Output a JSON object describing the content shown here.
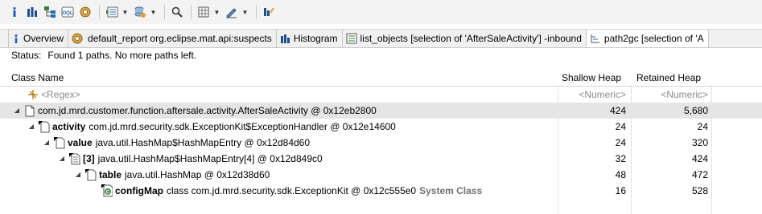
{
  "toolbar": {
    "icons": [
      "info-icon",
      "histogram-icon",
      "dominator-tree-icon",
      "oql-icon",
      "heap-dump-overview-icon",
      "query-browser-icon",
      "find-object-icon",
      "search-icon",
      "export-icon",
      "edit-icon",
      "pin-icon"
    ]
  },
  "tabs": [
    {
      "label": "Overview",
      "icon": "info-icon"
    },
    {
      "label": "default_report  org.eclipse.mat.api:suspects",
      "icon": "report-icon"
    },
    {
      "label": "Histogram",
      "icon": "histogram-icon"
    },
    {
      "label": "list_objects [selection of 'AfterSaleActivity'] -inbound",
      "icon": "list-objects-icon"
    },
    {
      "label": "path2gc [selection of 'A",
      "icon": "path2gc-icon"
    }
  ],
  "status": {
    "label": "Status:",
    "text": "Found 1 paths. No more paths left."
  },
  "columns": {
    "name": "Class Name",
    "shallow": "Shallow Heap",
    "retained": "Retained Heap"
  },
  "filter": {
    "regex": "<Regex>",
    "numeric_shallow": "<Numeric>",
    "numeric_retained": "<Numeric>"
  },
  "rows": [
    {
      "field": "",
      "text": "com.jd.mrd.customer.function.aftersale.activity.AfterSaleActivity @ 0x12eb2800",
      "extra": "",
      "shallow": "424",
      "retained": "5,680"
    },
    {
      "field": "activity",
      "text": "com.jd.mrd.security.sdk.ExceptionKit$ExceptionHandler @ 0x12e14600",
      "extra": "",
      "shallow": "24",
      "retained": "24"
    },
    {
      "field": "value",
      "text": "java.util.HashMap$HashMapEntry @ 0x12d84d60",
      "extra": "",
      "shallow": "24",
      "retained": "320"
    },
    {
      "field": "[3]",
      "text": "java.util.HashMap$HashMapEntry[4] @ 0x12d849c0",
      "extra": "",
      "shallow": "32",
      "retained": "424"
    },
    {
      "field": "table",
      "text": "java.util.HashMap @ 0x12d38d60",
      "extra": "",
      "shallow": "48",
      "retained": "472"
    },
    {
      "field": "configMap",
      "text": "class com.jd.mrd.security.sdk.ExceptionKit @ 0x12c555e0",
      "extra": "System Class",
      "shallow": "16",
      "retained": "528"
    }
  ]
}
